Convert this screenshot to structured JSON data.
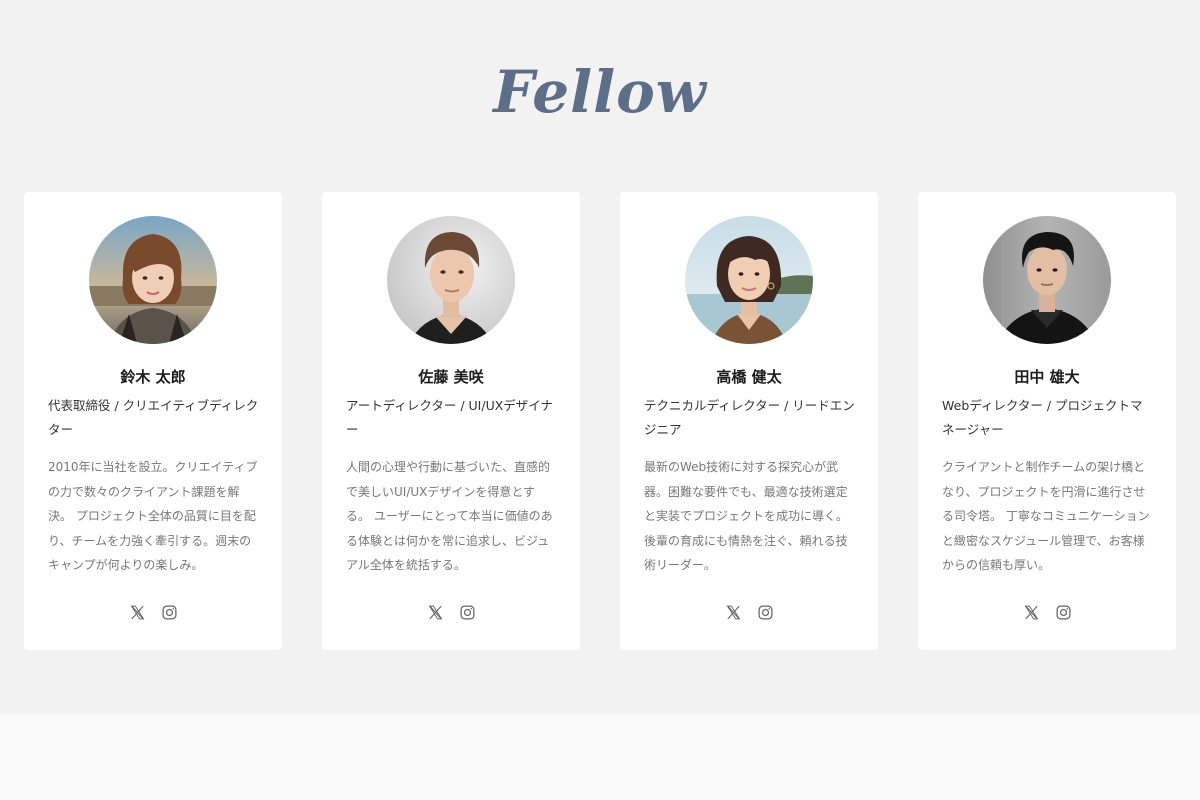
{
  "section": {
    "title": "Fellow"
  },
  "colors": {
    "title": "#5d6e89",
    "background": "#f2f2f2",
    "card": "#ffffff",
    "footer": "#fafafa"
  },
  "members": [
    {
      "name": "鈴木 太郎",
      "role": "代表取締役 / クリエイティブディレクター",
      "bio": "2010年に当社を設立。クリエイティブの力で数々のクライアント課題を解決。 プロジェクト全体の品質に目を配り、チームを力強く牽引する。週末のキャンプが何よりの楽しみ。",
      "social": [
        "x-icon",
        "instagram-icon"
      ]
    },
    {
      "name": "佐藤 美咲",
      "role": "アートディレクター / UI/UXデザイナー",
      "bio": "人間の心理や行動に基づいた、直感的で美しいUI/UXデザインを得意とする。 ユーザーにとって本当に価値のある体験とは何かを常に追求し、ビジュアル全体を統括する。",
      "social": [
        "x-icon",
        "instagram-icon"
      ]
    },
    {
      "name": "高橋 健太",
      "role": "テクニカルディレクター / リードエンジニア",
      "bio": "最新のWeb技術に対する探究心が武器。困難な要件でも、最適な技術選定と実装でプロジェクトを成功に導く。 後輩の育成にも情熱を注ぐ、頼れる技術リーダー。",
      "social": [
        "x-icon",
        "instagram-icon"
      ]
    },
    {
      "name": "田中 雄大",
      "role": "Webディレクター / プロジェクトマネージャー",
      "bio": "クライアントと制作チームの架け橋となり、プロジェクトを円滑に進行させる司令塔。 丁寧なコミュニケーションと緻密なスケジュール管理で、お客様からの信頼も厚い。",
      "social": [
        "x-icon",
        "instagram-icon"
      ]
    }
  ]
}
